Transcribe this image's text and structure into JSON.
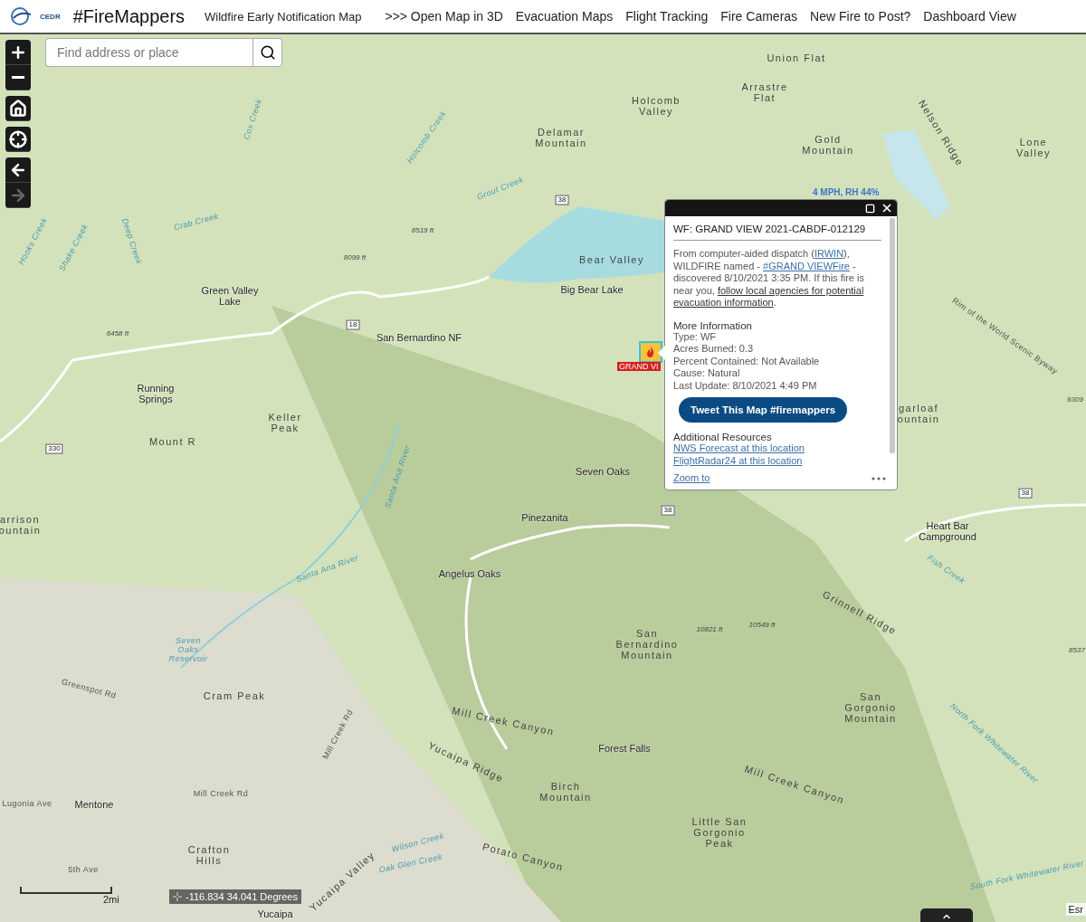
{
  "header": {
    "logo_text": "CEDR",
    "title": "#FireMappers",
    "subtitle": "Wildfire Early Notification Map",
    "nav": [
      {
        "label": ">>> Open Map in 3D"
      },
      {
        "label": "Evacuation Maps"
      },
      {
        "label": "Flight Tracking"
      },
      {
        "label": "Fire Cameras"
      },
      {
        "label": "New Fire to Post?"
      },
      {
        "label": "Dashboard View"
      }
    ]
  },
  "map_controls": [
    {
      "kind": "zoom-in",
      "disabled": false
    },
    {
      "kind": "zoom-out",
      "disabled": false
    },
    {
      "kind": "home",
      "disabled": false
    },
    {
      "kind": "locate",
      "disabled": false
    },
    {
      "kind": "back",
      "disabled": false
    },
    {
      "kind": "forward",
      "disabled": true
    }
  ],
  "search": {
    "placeholder": "Find address or place"
  },
  "wind_label": "4 MPH, RH 44%",
  "fire_marker": {
    "label": "GRAND VI"
  },
  "popup": {
    "title": "WF: GRAND VIEW 2021-CABDF-012129",
    "description": [
      {
        "kind": "text",
        "text": "From computer-aided dispatch ("
      },
      {
        "kind": "link",
        "text": "IRWIN"
      },
      {
        "kind": "text",
        "text": "), WILDFIRE named - "
      },
      {
        "kind": "link",
        "text": "#GRAND VIEWFire"
      },
      {
        "kind": "text",
        "text": " - discovered 8/10/2021 3:35 PM. If this fire is near you, "
      },
      {
        "kind": "link",
        "text": "follow local agencies for potential"
      },
      {
        "kind": "link",
        "text": "evacuation information"
      },
      {
        "kind": "text",
        "text": "."
      }
    ],
    "info_heading": "More Information",
    "info_lines": [
      "Type: WF",
      "Acres Burned: 0.3",
      "Percent Contained: Not Available",
      "Cause: Natural",
      "Last Update: 8/10/2021 4:49 PM"
    ],
    "tweet_button": "Tweet This Map #firemappers",
    "resources_heading": "Additional Resources",
    "resources": [
      "NWS Forecast at this location",
      "FlightRadar24 at this location"
    ],
    "zoom_link": "Zoom to"
  },
  "map_labels": [
    {
      "kind": "place",
      "text": "Union Flat"
    },
    {
      "kind": "place",
      "text": "Arrastre\nFlat"
    },
    {
      "kind": "place",
      "text": "Holcomb\nValley"
    },
    {
      "kind": "place",
      "text": "Delamar\nMountain"
    },
    {
      "kind": "place",
      "text": "Gold\nMountain"
    },
    {
      "kind": "place",
      "text": "Lone\nValley"
    },
    {
      "kind": "place",
      "text": "Bear Valley"
    },
    {
      "kind": "town",
      "text": "Big Bear Lake"
    },
    {
      "kind": "town",
      "text": "Green Valley\nLake"
    },
    {
      "kind": "town",
      "text": "San Bernardino NF"
    },
    {
      "kind": "town",
      "text": "Running\nSprings"
    },
    {
      "kind": "place",
      "text": "Keller\nPeak"
    },
    {
      "kind": "place",
      "text": "Mount R"
    },
    {
      "kind": "town",
      "text": "Seven Oaks"
    },
    {
      "kind": "town",
      "text": "Pinezanita"
    },
    {
      "kind": "town",
      "text": "Heart Bar\nCampground"
    },
    {
      "kind": "town",
      "text": "Angelus Oaks"
    },
    {
      "kind": "water",
      "text": "Seven\nOaks\nReservoir"
    },
    {
      "kind": "place",
      "text": "San\nBernardino\nMountain"
    },
    {
      "kind": "place",
      "text": "Cram Peak"
    },
    {
      "kind": "place",
      "text": "Mill Creek Canyon"
    },
    {
      "kind": "town",
      "text": "Forest Falls"
    },
    {
      "kind": "place",
      "text": "Yucaipa Ridge"
    },
    {
      "kind": "place",
      "text": "Birch\nMountain"
    },
    {
      "kind": "place",
      "text": "Mill Creek Canyon"
    },
    {
      "kind": "place",
      "text": "San\nGorgonio\nMountain"
    },
    {
      "kind": "place",
      "text": "Little San\nGorgonio\nPeak"
    },
    {
      "kind": "town",
      "text": "Mentone"
    },
    {
      "kind": "place",
      "text": "Crafton\nHills"
    },
    {
      "kind": "town",
      "text": "Yucaipa"
    },
    {
      "kind": "place",
      "text": "Potato Canyon"
    },
    {
      "kind": "place",
      "text": "Yucaipa Valley"
    },
    {
      "kind": "place",
      "text": "Grinnell Ridge"
    },
    {
      "kind": "road",
      "text": "Rim of the World Scenic Byway"
    },
    {
      "kind": "place",
      "text": "Nelson Ridge"
    },
    {
      "kind": "place",
      "text": "arrison\nountain"
    },
    {
      "kind": "place",
      "text": "garloaf\nountain"
    },
    {
      "kind": "road",
      "text": "Greenspot Rd"
    },
    {
      "kind": "road",
      "text": "Mill Creek Rd"
    },
    {
      "kind": "road",
      "text": "Lugonia Ave"
    },
    {
      "kind": "road",
      "text": "5th Ave"
    },
    {
      "kind": "road",
      "text": "Mill Creek Rd"
    },
    {
      "kind": "water",
      "text": "Crab Creek"
    },
    {
      "kind": "water",
      "text": "Grout Creek"
    },
    {
      "kind": "water",
      "text": "Holcomb Creek"
    },
    {
      "kind": "water",
      "text": "Cox Creek"
    },
    {
      "kind": "water",
      "text": "Deep Creek"
    },
    {
      "kind": "water",
      "text": "Hooks Creek"
    },
    {
      "kind": "water",
      "text": "Shake Creek"
    },
    {
      "kind": "water",
      "text": "Santa Ana River"
    },
    {
      "kind": "water",
      "text": "Santa Ana River"
    },
    {
      "kind": "water",
      "text": "Fish Creek"
    },
    {
      "kind": "water",
      "text": "Oak Glen Creek"
    },
    {
      "kind": "water",
      "text": "Wilson Creek"
    },
    {
      "kind": "water",
      "text": "South Fork Whitewater River"
    },
    {
      "kind": "water",
      "text": "North Fork Whitewater River"
    },
    {
      "kind": "elevation",
      "text": "8519 ft"
    },
    {
      "kind": "elevation",
      "text": "8099 ft"
    },
    {
      "kind": "elevation",
      "text": "6458 ft"
    },
    {
      "kind": "elevation",
      "text": "10821 ft"
    },
    {
      "kind": "elevation",
      "text": "10549 ft"
    },
    {
      "kind": "elevation",
      "text": "9309"
    },
    {
      "kind": "elevation",
      "text": "8537"
    },
    {
      "kind": "shield",
      "text": "38"
    },
    {
      "kind": "shield",
      "text": "18"
    },
    {
      "kind": "shield",
      "text": "330"
    },
    {
      "kind": "shield",
      "text": "38"
    },
    {
      "kind": "shield",
      "text": "38"
    }
  ],
  "scale_label": "2mi",
  "coordinates": "-116.834 34.041 Degrees",
  "attribution": "Esr"
}
